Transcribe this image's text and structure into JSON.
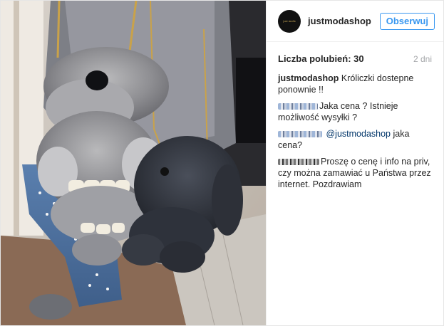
{
  "post": {
    "image_alt": "",
    "author": {
      "username": "justmodashop",
      "avatar_text": "just moda"
    },
    "follow_label": "Obserwuj",
    "likes_label": "Liczba polubień: 30",
    "time_label": "2 dni",
    "caption": {
      "username": "justmodashop",
      "text": "Króliczki dostepne ponownie !!"
    },
    "comments": [
      {
        "text": "Jaka cena ? Istnieje możliwość wysyłki ?"
      },
      {
        "mention": "@justmodashop",
        "text": " jaka cena?"
      },
      {
        "text": "Proszę o cenę i info na priv, czy można zamawiać u Państwa przez internet. Pozdrawiam"
      }
    ]
  },
  "colors": {
    "follow_blue": "#3897f0",
    "mention_blue": "#003569",
    "muted_gray": "#a5a7aa"
  }
}
